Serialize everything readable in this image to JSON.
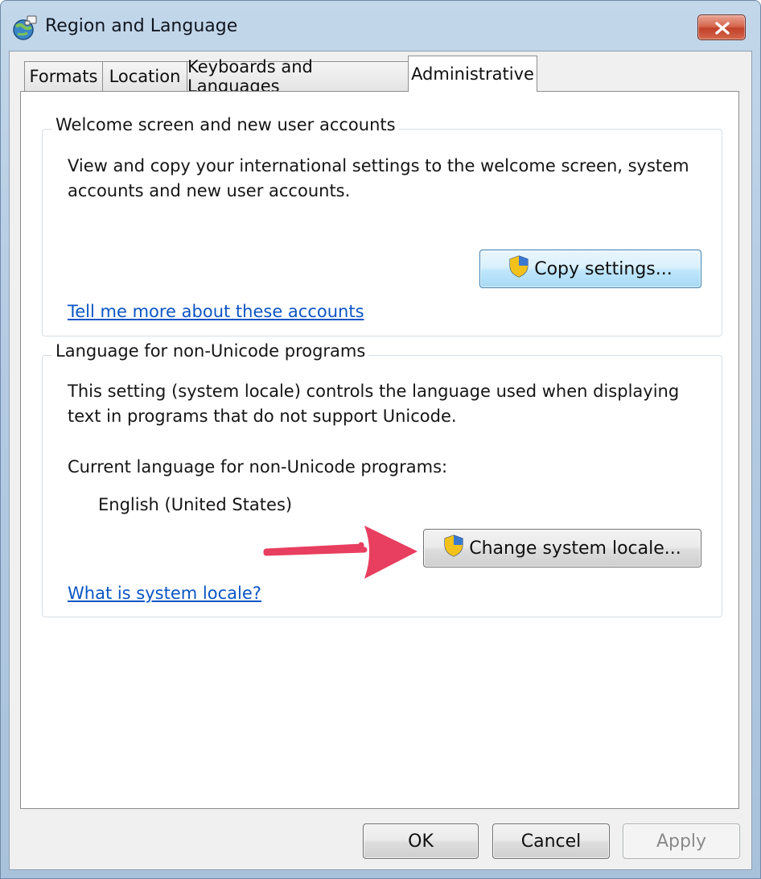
{
  "window": {
    "title": "Region and Language",
    "close_glyph": "✕"
  },
  "tabs": [
    {
      "label": "Formats",
      "active": false
    },
    {
      "label": "Location",
      "active": false
    },
    {
      "label": "Keyboards and Languages",
      "active": false
    },
    {
      "label": "Administrative",
      "active": true
    }
  ],
  "welcome_group": {
    "title": "Welcome screen and new user accounts",
    "description": "View and copy your international settings to the welcome screen, system accounts and new user accounts.",
    "copy_button_label": "Copy settings...",
    "link": "Tell me more about these accounts"
  },
  "locale_group": {
    "title": "Language for non-Unicode programs",
    "description": "This setting (system locale) controls the language used when displaying text in programs that do not support Unicode.",
    "current_label": "Current language for non-Unicode programs:",
    "current_value": "English (United States)",
    "change_button_label": "Change system locale...",
    "link": "What is system locale?"
  },
  "footer": {
    "ok_label": "OK",
    "cancel_label": "Cancel",
    "apply_label": "Apply",
    "apply_enabled": false
  },
  "icons": {
    "window_icon": "globe-icon",
    "uac": "uac-shield-icon",
    "annotation": "arrow-icon"
  },
  "colors": {
    "link": "#0b55c4",
    "annotation_arrow": "#e83e5f",
    "focused_button": "#bee6fd"
  }
}
